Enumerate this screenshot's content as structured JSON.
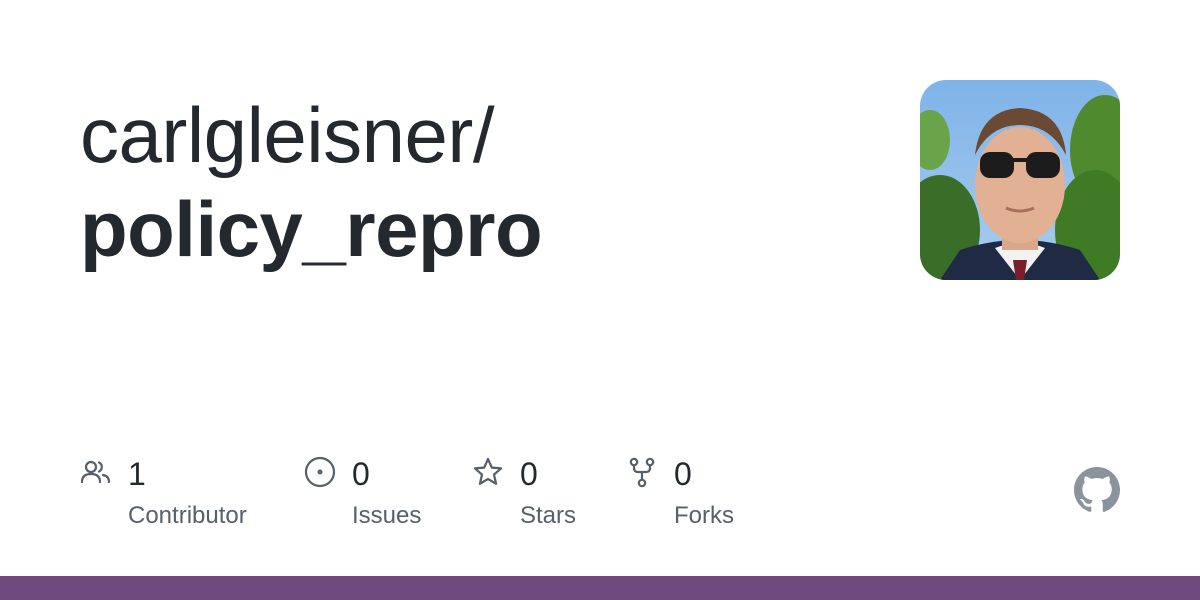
{
  "repo": {
    "owner": "carlgleisner/",
    "name": "policy_repro"
  },
  "avatar": {
    "alt": "carlgleisner"
  },
  "stats": {
    "contributors": {
      "count": "1",
      "label": "Contributor",
      "icon": "people-icon"
    },
    "issues": {
      "count": "0",
      "label": "Issues",
      "icon": "issue-opened-icon"
    },
    "stars": {
      "count": "0",
      "label": "Stars",
      "icon": "star-icon"
    },
    "forks": {
      "count": "0",
      "label": "Forks",
      "icon": "repo-forked-icon"
    }
  },
  "colors": {
    "text": "#24292f",
    "muted": "#57606a",
    "icon": "#57606a",
    "language_bar": "#6e4a7e",
    "github_logo": "#8b949e"
  }
}
